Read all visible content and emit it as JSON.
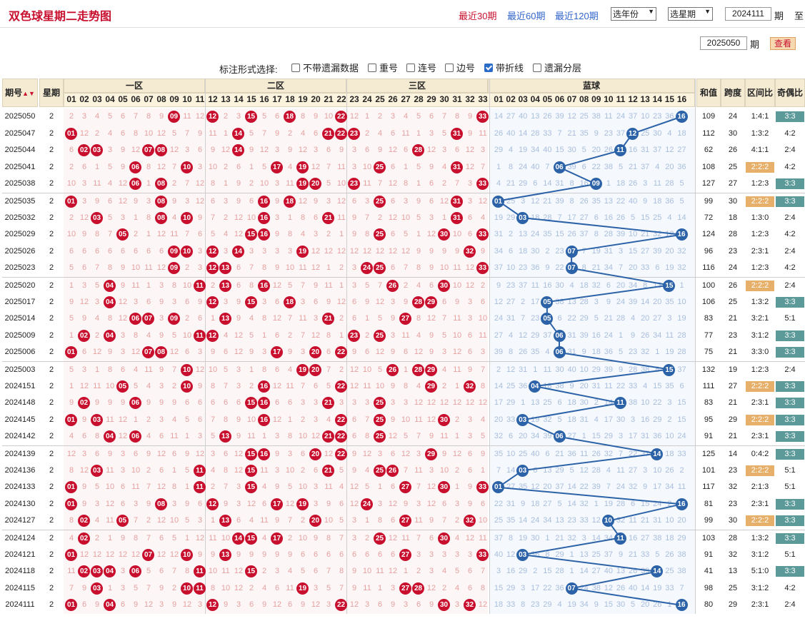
{
  "header": {
    "title": "双色球星期二走势图",
    "links": [
      "最近30期",
      "最近60期",
      "最近120期"
    ],
    "year_select": "选年份",
    "week_select": "选星期",
    "start_issue": "2024111",
    "period_label": "期",
    "to_label": "至",
    "end_issue": "2025050",
    "period_label2": "期",
    "query_button": "查看"
  },
  "options": {
    "label": "标注形式选择:",
    "items": [
      {
        "label": "不带遗漏数据",
        "checked": false
      },
      {
        "label": "重号",
        "checked": false
      },
      {
        "label": "连号",
        "checked": false
      },
      {
        "label": "边号",
        "checked": false
      },
      {
        "label": "带折线",
        "checked": true
      },
      {
        "label": "遗漏分层",
        "checked": false
      }
    ]
  },
  "table": {
    "col_issue": "期号",
    "col_week": "星期",
    "zones": [
      "一区",
      "二区",
      "三区"
    ],
    "blue_header": "蓝球",
    "col_sum": "和值",
    "col_span": "跨度",
    "col_zone_ratio": "区间比",
    "col_odd_even": "奇偶比",
    "red_nums": [
      "01",
      "02",
      "03",
      "04",
      "05",
      "06",
      "07",
      "08",
      "09",
      "10",
      "11",
      "12",
      "13",
      "14",
      "15",
      "16",
      "17",
      "18",
      "19",
      "20",
      "21",
      "22",
      "23",
      "24",
      "25",
      "26",
      "27",
      "28",
      "29",
      "30",
      "31",
      "32",
      "33"
    ],
    "blue_nums": [
      "01",
      "02",
      "03",
      "04",
      "05",
      "06",
      "07",
      "08",
      "09",
      "10",
      "11",
      "12",
      "13",
      "14",
      "15",
      "16"
    ],
    "rows": [
      {
        "issue": "2025050",
        "week": "2",
        "reds": [
          9,
          12,
          15,
          18,
          22,
          33
        ],
        "blue": 16,
        "sum": "109",
        "span": "24",
        "zone": "1:4:1",
        "oe": "3:3"
      },
      {
        "issue": "2025047",
        "week": "2",
        "reds": [
          1,
          14,
          21,
          22,
          23,
          31
        ],
        "blue": 12,
        "sum": "112",
        "span": "30",
        "zone": "1:3:2",
        "oe": "4:2"
      },
      {
        "issue": "2025044",
        "week": "2",
        "reds": [
          2,
          3,
          7,
          8,
          14,
          28
        ],
        "blue": 11,
        "sum": "62",
        "span": "26",
        "zone": "4:1:1",
        "oe": "2:4"
      },
      {
        "issue": "2025041",
        "week": "2",
        "reds": [
          6,
          10,
          17,
          19,
          25,
          31
        ],
        "blue": 6,
        "sum": "108",
        "span": "25",
        "zone": "2:2:2",
        "oe": "4:2"
      },
      {
        "issue": "2025038",
        "week": "2",
        "reds": [
          6,
          8,
          19,
          20,
          23,
          33
        ],
        "blue": 9,
        "sum": "127",
        "span": "27",
        "zone": "1:2:3",
        "oe": "3:3"
      },
      {
        "issue": "2025035",
        "week": "2",
        "reds": [
          1,
          8,
          16,
          18,
          25,
          31
        ],
        "blue": 1,
        "sum": "99",
        "span": "30",
        "zone": "2:2:2",
        "oe": "3:3"
      },
      {
        "issue": "2025032",
        "week": "2",
        "reds": [
          3,
          8,
          10,
          16,
          21,
          31
        ],
        "blue": 3,
        "sum": "72",
        "span": "18",
        "zone": "1:3:0",
        "oe": "2:4"
      },
      {
        "issue": "2025029",
        "week": "2",
        "reds": [
          5,
          15,
          16,
          25,
          30,
          33
        ],
        "blue": 16,
        "sum": "124",
        "span": "28",
        "zone": "1:2:3",
        "oe": "4:2"
      },
      {
        "issue": "2025026",
        "week": "2",
        "reds": [
          9,
          10,
          12,
          14,
          19,
          32
        ],
        "blue": 7,
        "sum": "96",
        "span": "23",
        "zone": "2:3:1",
        "oe": "2:4"
      },
      {
        "issue": "2025023",
        "week": "2",
        "reds": [
          9,
          12,
          13,
          24,
          25,
          33
        ],
        "blue": 7,
        "sum": "116",
        "span": "24",
        "zone": "1:2:3",
        "oe": "4:2"
      },
      {
        "issue": "2025020",
        "week": "2",
        "reds": [
          4,
          11,
          13,
          16,
          26,
          30
        ],
        "blue": 15,
        "sum": "100",
        "span": "26",
        "zone": "2:2:2",
        "oe": "2:4"
      },
      {
        "issue": "2025017",
        "week": "2",
        "reds": [
          4,
          12,
          15,
          18,
          28,
          29
        ],
        "blue": 5,
        "sum": "106",
        "span": "25",
        "zone": "1:3:2",
        "oe": "3:3"
      },
      {
        "issue": "2025014",
        "week": "2",
        "reds": [
          6,
          7,
          9,
          13,
          21,
          27
        ],
        "blue": 5,
        "sum": "83",
        "span": "21",
        "zone": "3:2:1",
        "oe": "5:1"
      },
      {
        "issue": "2025009",
        "week": "2",
        "reds": [
          2,
          4,
          11,
          12,
          23,
          25
        ],
        "blue": 6,
        "sum": "77",
        "span": "23",
        "zone": "3:1:2",
        "oe": "3:3"
      },
      {
        "issue": "2025006",
        "week": "2",
        "reds": [
          1,
          7,
          8,
          17,
          20,
          22
        ],
        "blue": 6,
        "sum": "75",
        "span": "21",
        "zone": "3:3:0",
        "oe": "3:3"
      },
      {
        "issue": "2025003",
        "week": "2",
        "reds": [
          10,
          19,
          20,
          26,
          28,
          29
        ],
        "blue": 15,
        "sum": "132",
        "span": "19",
        "zone": "1:2:3",
        "oe": "2:4"
      },
      {
        "issue": "2024151",
        "week": "2",
        "reds": [
          5,
          10,
          16,
          22,
          29,
          32
        ],
        "blue": 4,
        "sum": "111",
        "span": "27",
        "zone": "2:2:2",
        "oe": "3:3"
      },
      {
        "issue": "2024148",
        "week": "2",
        "reds": [
          2,
          6,
          15,
          16,
          21,
          25
        ],
        "blue": 11,
        "sum": "83",
        "span": "21",
        "zone": "2:3:1",
        "oe": "3:3"
      },
      {
        "issue": "2024145",
        "week": "2",
        "reds": [
          1,
          3,
          16,
          22,
          25,
          30
        ],
        "blue": 3,
        "sum": "95",
        "span": "29",
        "zone": "2:2:2",
        "oe": "3:3"
      },
      {
        "issue": "2024142",
        "week": "2",
        "reds": [
          4,
          6,
          13,
          21,
          22,
          25
        ],
        "blue": 6,
        "sum": "91",
        "span": "21",
        "zone": "2:3:1",
        "oe": "3:3"
      },
      {
        "issue": "2024139",
        "week": "2",
        "reds": [
          15,
          16,
          20,
          22,
          29
        ],
        "blue": 14,
        "sum": "125",
        "span": "14",
        "zone": "0:4:2",
        "oe": "3:3"
      },
      {
        "issue": "2024136",
        "week": "2",
        "reds": [
          3,
          11,
          15,
          21,
          25,
          26
        ],
        "blue": 3,
        "sum": "101",
        "span": "23",
        "zone": "2:2:2",
        "oe": "5:1"
      },
      {
        "issue": "2024133",
        "week": "2",
        "reds": [
          1,
          11,
          15,
          27,
          30,
          33
        ],
        "blue": 1,
        "sum": "117",
        "span": "32",
        "zone": "2:1:3",
        "oe": "5:1"
      },
      {
        "issue": "2024130",
        "week": "2",
        "reds": [
          1,
          8,
          12,
          17,
          19,
          24
        ],
        "blue": 16,
        "sum": "81",
        "span": "23",
        "zone": "2:3:1",
        "oe": "3:3"
      },
      {
        "issue": "2024127",
        "week": "2",
        "reds": [
          2,
          5,
          13,
          20,
          27,
          32
        ],
        "blue": 10,
        "sum": "99",
        "span": "30",
        "zone": "2:2:2",
        "oe": "3:3"
      },
      {
        "issue": "2024124",
        "week": "2",
        "reds": [
          2,
          14,
          15,
          17,
          25,
          30
        ],
        "blue": 11,
        "sum": "103",
        "span": "28",
        "zone": "1:3:2",
        "oe": "3:3"
      },
      {
        "issue": "2024121",
        "week": "2",
        "reds": [
          1,
          7,
          10,
          13,
          27,
          33
        ],
        "blue": 3,
        "sum": "91",
        "span": "32",
        "zone": "3:1:2",
        "oe": "5:1"
      },
      {
        "issue": "2024118",
        "week": "2",
        "reds": [
          2,
          3,
          4,
          6,
          11,
          15
        ],
        "blue": 14,
        "sum": "41",
        "span": "13",
        "zone": "5:1:0",
        "oe": "3:3"
      },
      {
        "issue": "2024115",
        "week": "2",
        "reds": [
          3,
          10,
          11,
          19,
          27,
          28
        ],
        "blue": 7,
        "sum": "98",
        "span": "25",
        "zone": "3:1:2",
        "oe": "4:2"
      },
      {
        "issue": "2024111",
        "week": "2",
        "reds": [
          1,
          4,
          12,
          22,
          30,
          32
        ],
        "blue": 16,
        "sum": "80",
        "span": "29",
        "zone": "2:3:1",
        "oe": "2:4"
      }
    ]
  },
  "colors": {
    "red_ball": "#c8102e",
    "blue_ball": "#2c63a8",
    "badge_teal": "#5c9a9a",
    "badge_tan": "#e6b06b",
    "trend_line": "#2c63a8"
  },
  "icons": {
    "sort": "sort-arrows-icon"
  }
}
